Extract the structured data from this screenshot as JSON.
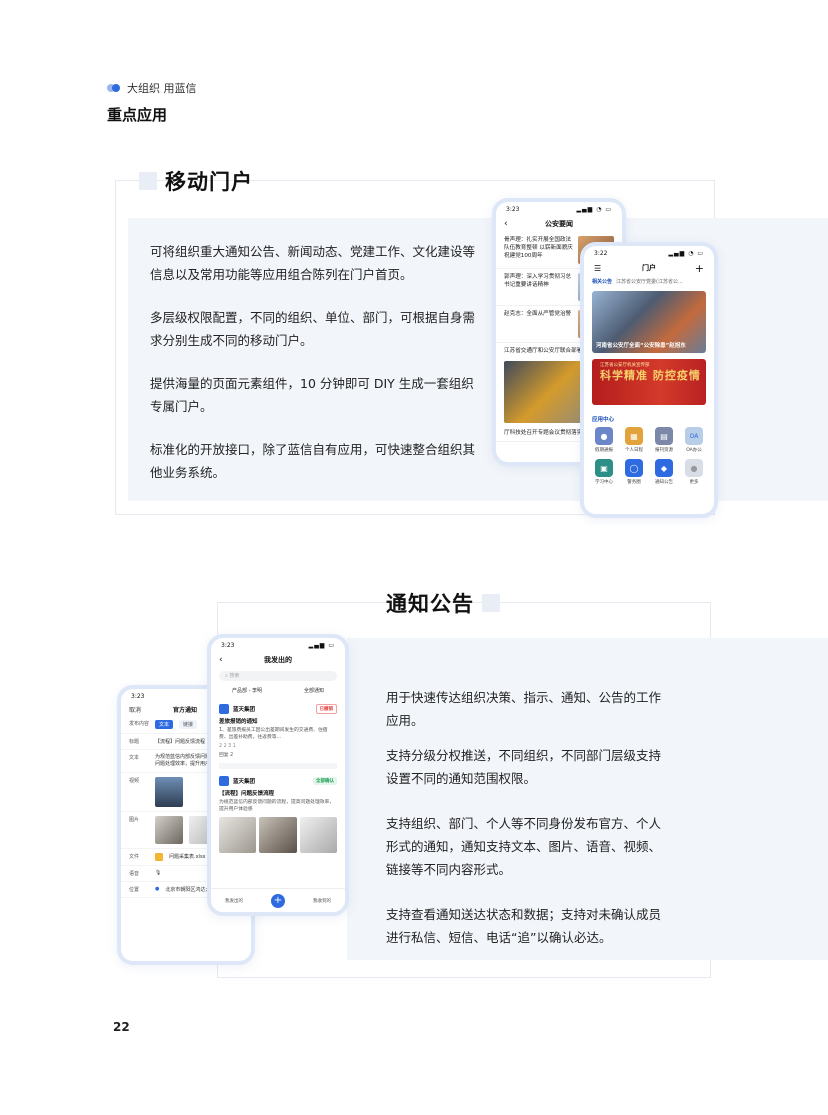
{
  "header": {
    "brand": "大组织 用蓝信",
    "section_title": "重点应用"
  },
  "portal": {
    "title": "移动门户",
    "paragraphs": [
      "可将组织重大通知公告、新闻动态、党建工作、文化建设等信息以及常用功能等应用组合陈列在门户首页。",
      "多层级权限配置，不同的组织、单位、部门，可根据自身需求分别生成不同的移动门户。",
      "提供海量的页面元素组件，10 分钟即可 DIY 生成一套组织专属门户。",
      "标准化的开放接口，除了蓝信自有应用，可快速整合组织其他业务系统。"
    ],
    "phone_news": {
      "time": "3:23",
      "title": "公安要闻",
      "items": [
        "骨声理：扎实开展全国政法队伍教育整顿 以崭新面貌庆祝建党100周年",
        "郭声理：深入学习贯彻习总书记重要讲话精神",
        "赵克志：全面从严管党治警",
        "江苏省交通厅和公安厅联合部署",
        "厅科技处召开专题会议贯彻落实"
      ]
    },
    "phone_portal": {
      "time": "3:22",
      "title": "门户",
      "tabs": [
        "相关公告",
        "江苏省公安厅党委(江苏省公..."
      ],
      "banner_caption": "河南省公安厅全面“公安除患”赵旭东",
      "banner2_small": "江苏省公安厅机关宣传部",
      "banner2_text": "科学精准 防控疫情",
      "apps_title": "应用中心",
      "apps": [
        {
          "label": "假期通报",
          "color": "#6b87c9"
        },
        {
          "label": "个人日程",
          "color": "#e3a33c"
        },
        {
          "label": "报刊资源",
          "color": "#7b88a8"
        },
        {
          "label": "OA办公",
          "color": "#b8cde8"
        },
        {
          "label": "学习中心",
          "color": "#2d8f86"
        },
        {
          "label": "警务圈",
          "color": "#2f6be0"
        },
        {
          "label": "通知公告",
          "color": "#2f6be0"
        },
        {
          "label": "更多",
          "color": "#d8dde6"
        }
      ]
    }
  },
  "notice": {
    "title": "通知公告",
    "paragraphs": [
      "用于快速传达组织决策、指示、通知、公告的工作应用。",
      "支持分级分权推送，不同组织，不同部门层级支持设置不同的通知范围权限。",
      "支持组织、部门、个人等不同身份发布官方、个人形式的通知，通知支持文本、图片、语音、视频、链接等不同内容形式。",
      "支持查看通知送达状态和数据；支持对未确认成员进行私信、短信、电话“追”以确认必达。"
    ],
    "phone_compose": {
      "time": "3:23",
      "cancel": "取消",
      "title": "官方通知",
      "fields": [
        {
          "label": "发布内容",
          "value": ""
        },
        {
          "label": "标题",
          "value": "【流程】问题反馈流程"
        },
        {
          "label": "文本",
          "value": "为规范蓝信内部反馈问题的流程，提高问题处理效率，提升用户..."
        },
        {
          "label": "视频",
          "value": ""
        },
        {
          "label": "图片",
          "value": ""
        },
        {
          "label": "文件",
          "value": "问题采集表.xlsx"
        },
        {
          "label": "语音",
          "value": ""
        },
        {
          "label": "位置",
          "value": "北京市朝阳区鸿达大厦"
        }
      ],
      "type_tabs": [
        "文本",
        "链接"
      ]
    },
    "phone_sent": {
      "time": "3:23",
      "title": "我发出的",
      "search_placeholder": "搜索",
      "filters": [
        "产品部 - 李明",
        "全部通知"
      ],
      "card1": {
        "org": "蓝天集团",
        "tag": "已撤销",
        "title": "差旅报销的通知",
        "body": "1、差旅费报员工因公出差期间发生的交通费、住宿费、出差补助费，往返费等...",
        "meta": "2  2  3  1",
        "reply": "回复 2"
      },
      "card2": {
        "org": "蓝天集团",
        "tag": "全部确认",
        "title": "【流程】问题反馈流程",
        "body": "为规范蓝信内部反馈问题的流程，提高问题处理效率，提升用户体验感"
      },
      "bottom": [
        "我发出的",
        "我收到的"
      ]
    }
  },
  "page_number": "22"
}
